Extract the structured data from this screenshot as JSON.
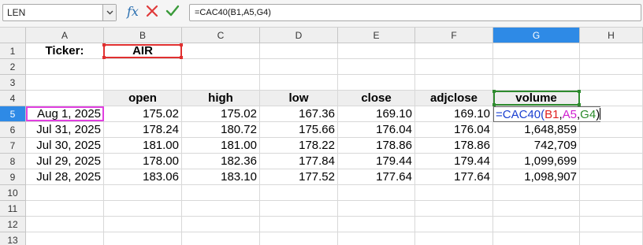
{
  "formula_bar": {
    "name_box": "LEN",
    "fx_symbol": "fx",
    "formula": "=CAC40(B1,A5,G4)"
  },
  "columns": [
    "A",
    "B",
    "C",
    "D",
    "E",
    "F",
    "G",
    "H"
  ],
  "rows": [
    "1",
    "2",
    "3",
    "4",
    "5",
    "6",
    "7",
    "8",
    "9",
    "10",
    "11",
    "12",
    "13"
  ],
  "active": {
    "column": "G",
    "row": "5"
  },
  "cells": {
    "A1": "Ticker:",
    "B1": "AIR",
    "B4": "open",
    "C4": "high",
    "D4": "low",
    "E4": "close",
    "F4": "adjclose",
    "G4": "volume",
    "A5": "Aug 1, 2025",
    "B5": "175.02",
    "C5": "175.02",
    "D5": "167.36",
    "E5": "169.10",
    "F5": "169.10",
    "A6": "Jul 31, 2025",
    "B6": "178.24",
    "C6": "180.72",
    "D6": "175.66",
    "E6": "176.04",
    "F6": "176.04",
    "G6": "1,648,859",
    "A7": "Jul 30, 2025",
    "B7": "181.00",
    "C7": "181.00",
    "D7": "178.22",
    "E7": "178.86",
    "F7": "178.86",
    "G7": "742,709",
    "A8": "Jul 29, 2025",
    "B8": "178.00",
    "C8": "182.36",
    "D8": "177.84",
    "E8": "179.44",
    "F8": "179.44",
    "G8": "1,099,699",
    "A9": "Jul 28, 2025",
    "B9": "183.06",
    "C9": "183.10",
    "D9": "177.52",
    "E9": "177.64",
    "F9": "177.64",
    "G9": "1,098,907"
  },
  "editing_formula": {
    "prefix": "=CAC40(",
    "ref1": "B1",
    "sep1": ",",
    "ref2": "A5",
    "sep2": ",",
    "ref3": "G4",
    "suffix": ")"
  },
  "colors": {
    "active_header": "#2e8ae6",
    "ref_b1": "#e02020",
    "ref_a5": "#d020d0",
    "ref_g4": "#2a8a2a",
    "function_name": "#1a3fd0"
  }
}
